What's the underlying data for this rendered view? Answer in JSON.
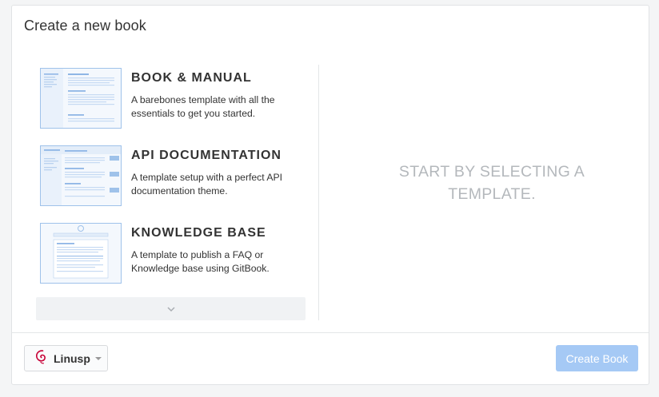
{
  "modal": {
    "title": "Create a new book"
  },
  "templates": [
    {
      "name": "BOOK & MANUAL",
      "description": "A barebones template with all the essentials to get you started.",
      "thumb": "book-manual-thumbnail"
    },
    {
      "name": "API DOCUMENTATION",
      "description": "A template setup with a perfect API documentation theme.",
      "thumb": "api-docs-thumbnail"
    },
    {
      "name": "KNOWLEDGE BASE",
      "description": "A template to publish a FAQ or Knowledge base using GitBook.",
      "thumb": "knowledge-base-thumbnail"
    }
  ],
  "more_icon": "chevron-down-icon",
  "placeholder": "START BY SELECTING A TEMPLATE.",
  "footer": {
    "owner": {
      "name": "Linusp",
      "avatar_icon": "debian-swirl-icon",
      "avatar_color": "#c70036"
    },
    "create_label": "Create Book",
    "create_disabled": true
  },
  "colors": {
    "accent_disabled": "#a5c9f5",
    "thumb_border": "#9fc2ea",
    "placeholder_text": "#b4b8bc"
  }
}
